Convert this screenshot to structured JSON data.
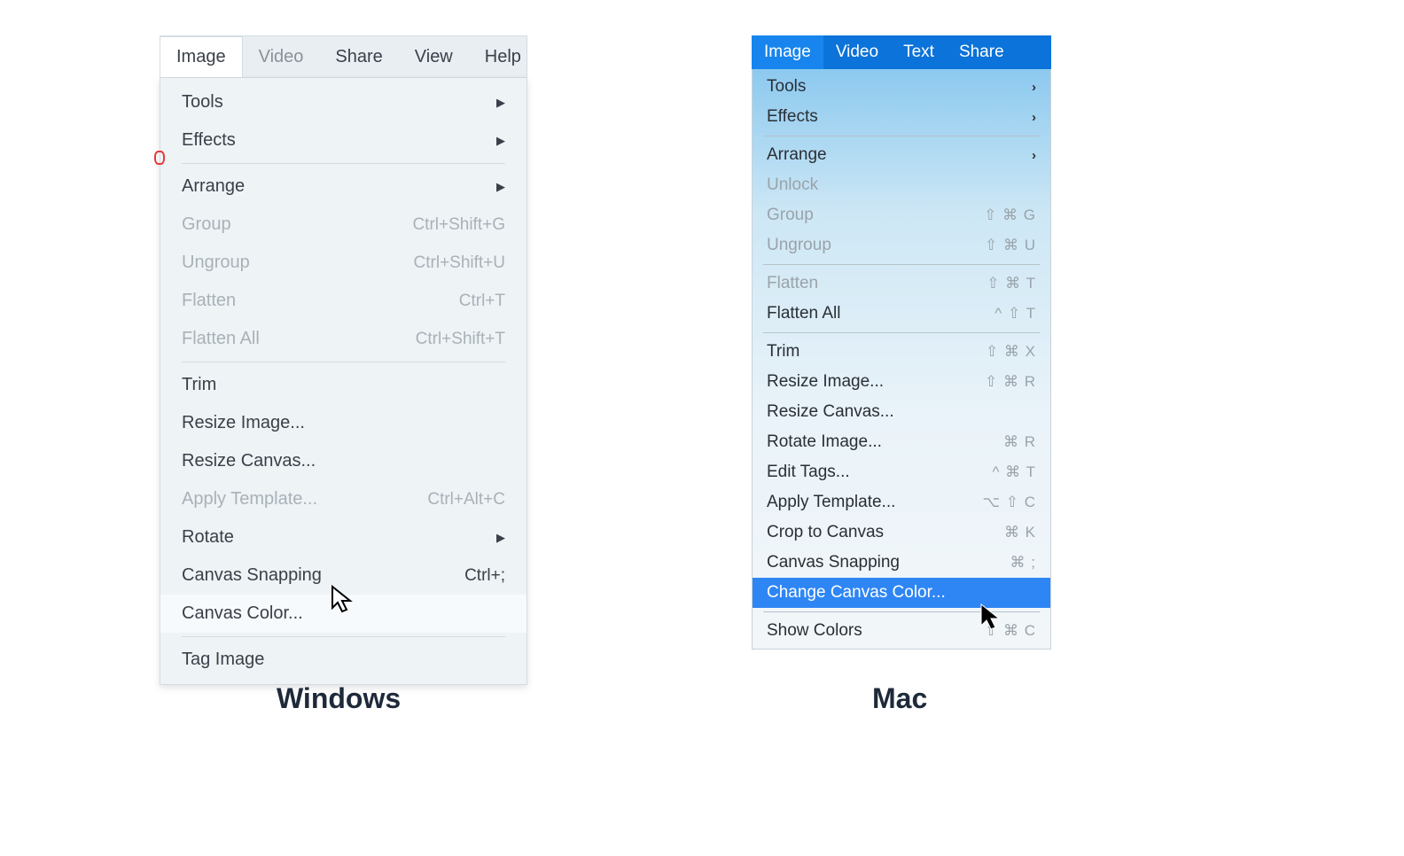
{
  "windows": {
    "menubar": [
      "Image",
      "Video",
      "Share",
      "View",
      "Help"
    ],
    "items": {
      "tools": "Tools",
      "effects": "Effects",
      "arrange": "Arrange",
      "group": "Group",
      "group_sc": "Ctrl+Shift+G",
      "ungroup": "Ungroup",
      "ungroup_sc": "Ctrl+Shift+U",
      "flatten": "Flatten",
      "flatten_sc": "Ctrl+T",
      "flatten_all": "Flatten All",
      "flatten_all_sc": "Ctrl+Shift+T",
      "trim": "Trim",
      "resize_image": "Resize Image...",
      "resize_canvas": "Resize Canvas...",
      "apply_template": "Apply Template...",
      "apply_template_sc": "Ctrl+Alt+C",
      "rotate": "Rotate",
      "canvas_snapping": "Canvas Snapping",
      "canvas_snapping_sc": "Ctrl+;",
      "canvas_color": "Canvas Color...",
      "tag_image": "Tag Image"
    }
  },
  "mac": {
    "menubar": [
      "Image",
      "Video",
      "Text",
      "Share"
    ],
    "items": {
      "tools": "Tools",
      "effects": "Effects",
      "arrange": "Arrange",
      "unlock": "Unlock",
      "group": "Group",
      "group_sc": "⇧ ⌘ G",
      "ungroup": "Ungroup",
      "ungroup_sc": "⇧ ⌘ U",
      "flatten": "Flatten",
      "flatten_sc": "⇧ ⌘ T",
      "flatten_all": "Flatten All",
      "flatten_all_sc": "^ ⇧ T",
      "trim": "Trim",
      "trim_sc": "⇧ ⌘ X",
      "resize_image": "Resize Image...",
      "resize_image_sc": "⇧ ⌘ R",
      "resize_canvas": "Resize Canvas...",
      "rotate_image": "Rotate Image...",
      "rotate_image_sc": "⌘ R",
      "edit_tags": "Edit Tags...",
      "edit_tags_sc": "^ ⌘ T",
      "apply_template": "Apply Template...",
      "apply_template_sc": "⌥ ⇧ C",
      "crop_canvas": "Crop to Canvas",
      "crop_canvas_sc": "⌘ K",
      "canvas_snapping": "Canvas Snapping",
      "canvas_snapping_sc": "⌘ ;",
      "change_canvas_color": "Change Canvas Color...",
      "show_colors": "Show Colors",
      "show_colors_sc": "⇧ ⌘ C"
    }
  },
  "labels": {
    "windows": "Windows",
    "mac": "Mac"
  }
}
